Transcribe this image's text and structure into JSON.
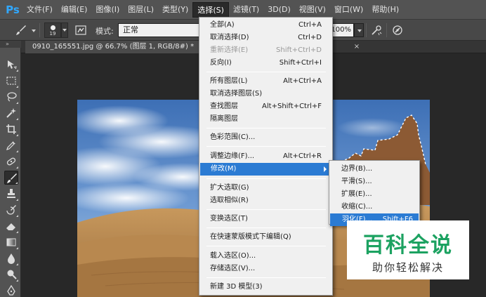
{
  "app": {
    "logo": "Ps",
    "colors": {
      "menu_bg": "#535353",
      "options_bg": "#484848",
      "canvas_bg": "#282828",
      "menu_highlight": "#2b7bd3",
      "logo_color": "#31a8ff",
      "watermark_green": "#1ca261"
    }
  },
  "menubar": {
    "items": [
      {
        "label": "文件(F)"
      },
      {
        "label": "编辑(E)"
      },
      {
        "label": "图像(I)"
      },
      {
        "label": "图层(L)"
      },
      {
        "label": "类型(Y)"
      },
      {
        "label": "选择(S)",
        "active": true
      },
      {
        "label": "滤镜(T)"
      },
      {
        "label": "3D(D)"
      },
      {
        "label": "视图(V)"
      },
      {
        "label": "窗口(W)"
      },
      {
        "label": "帮助(H)"
      }
    ]
  },
  "options_bar": {
    "tool_icon": "brush-icon",
    "brush_size": "19",
    "mode_label": "模式:",
    "mode_value": "正常",
    "opacity_value": "100%",
    "icons": [
      "brush-panel-icon",
      "airbrush-icon",
      "tablet-pressure-icon"
    ]
  },
  "document_tab": {
    "title": "0910_165551.jpg @ 66.7% (图层 1, RGB/8#) *",
    "close_label": "×"
  },
  "toolbar": {
    "grip": "»",
    "tools": [
      "move-tool-icon",
      "rect-marquee-icon",
      "lasso-icon",
      "quick-select-icon",
      "crop-icon",
      "eyedropper-icon",
      "healing-brush-icon",
      "brush-tool-icon",
      "clone-stamp-icon",
      "history-brush-icon",
      "eraser-icon",
      "gradient-icon",
      "blur-icon",
      "dodge-icon",
      "pen-icon"
    ],
    "selected_tool": "brush-tool-icon"
  },
  "select_menu": {
    "items": [
      {
        "label": "全部(A)",
        "shortcut": "Ctrl+A"
      },
      {
        "label": "取消选择(D)",
        "shortcut": "Ctrl+D"
      },
      {
        "label": "重新选择(E)",
        "shortcut": "Shift+Ctrl+D",
        "disabled": true
      },
      {
        "label": "反向(I)",
        "shortcut": "Shift+Ctrl+I"
      },
      {
        "label": "所有图层(L)",
        "shortcut": "Alt+Ctrl+A"
      },
      {
        "label": "取消选择图层(S)",
        "shortcut": ""
      },
      {
        "label": "查找图层",
        "shortcut": "Alt+Shift+Ctrl+F"
      },
      {
        "label": "隔离图层",
        "shortcut": ""
      },
      {
        "label": "色彩范围(C)...",
        "shortcut": ""
      },
      {
        "label": "调整边缘(F)...",
        "shortcut": "Alt+Ctrl+R"
      },
      {
        "label": "修改(M)",
        "shortcut": "",
        "highlight": true,
        "submenu": true
      },
      {
        "label": "扩大选取(G)",
        "shortcut": ""
      },
      {
        "label": "选取相似(R)",
        "shortcut": ""
      },
      {
        "label": "变换选区(T)",
        "shortcut": ""
      },
      {
        "label": "在快速蒙版模式下编辑(Q)",
        "shortcut": ""
      },
      {
        "label": "载入选区(O)...",
        "shortcut": ""
      },
      {
        "label": "存储选区(V)...",
        "shortcut": ""
      },
      {
        "label": "新建 3D 模型(3)",
        "shortcut": ""
      }
    ]
  },
  "modify_submenu": {
    "items": [
      {
        "label": "边界(B)...",
        "shortcut": ""
      },
      {
        "label": "平滑(S)...",
        "shortcut": ""
      },
      {
        "label": "扩展(E)...",
        "shortcut": ""
      },
      {
        "label": "收缩(C)...",
        "shortcut": ""
      },
      {
        "label": "羽化(F)...",
        "shortcut": "Shift+F6",
        "highlight": true
      }
    ]
  },
  "watermark": {
    "title": "百科全说",
    "subtitle": "助你轻松解决"
  }
}
